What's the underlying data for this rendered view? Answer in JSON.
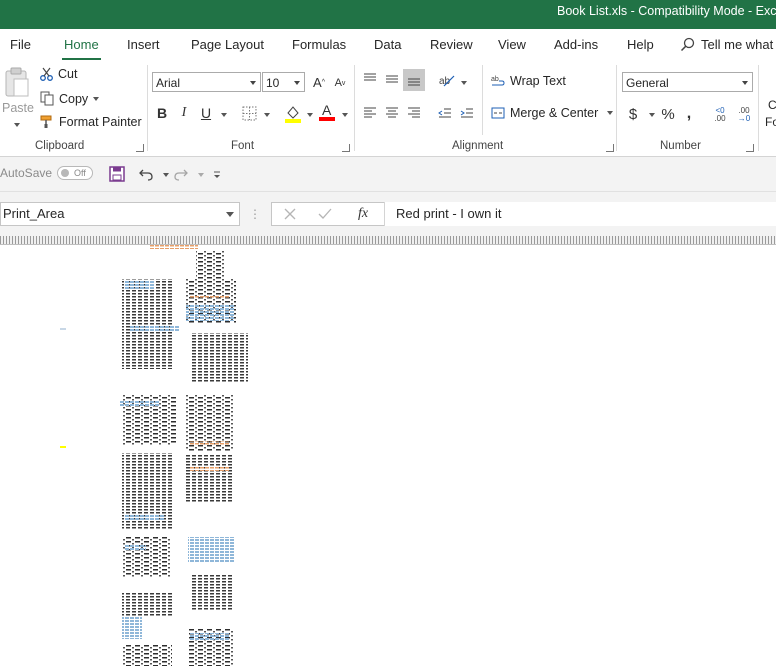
{
  "window": {
    "title": "Book List.xls  -  Compatibility Mode  -  Exc"
  },
  "ribbon_tabs": [
    {
      "label": "File"
    },
    {
      "label": "Home"
    },
    {
      "label": "Insert"
    },
    {
      "label": "Page Layout"
    },
    {
      "label": "Formulas"
    },
    {
      "label": "Data"
    },
    {
      "label": "Review"
    },
    {
      "label": "View"
    },
    {
      "label": "Add-ins"
    },
    {
      "label": "Help"
    }
  ],
  "tell_me": "Tell me what",
  "clipboard": {
    "paste": "Paste",
    "cut": "Cut",
    "copy": "Copy",
    "format_painter": "Format Painter",
    "group_label": "Clipboard"
  },
  "font": {
    "name": "Arial",
    "size": "10",
    "group_label": "Font"
  },
  "alignment": {
    "wrap_text": "Wrap Text",
    "merge_center": "Merge & Center",
    "group_label": "Alignment"
  },
  "number": {
    "format": "General",
    "group_label": "Number",
    "clip_1": "C",
    "clip_2": "Fo"
  },
  "qat": {
    "autosave": "AutoSave",
    "toggle": "Off"
  },
  "formula_bar": {
    "name_box": "Print_Area",
    "fx": "fx",
    "content": "Red print - I own it"
  },
  "colors": {
    "excel_green": "#217346",
    "highlight_yellow": "#ffff00",
    "font_red": "#ff0000"
  }
}
